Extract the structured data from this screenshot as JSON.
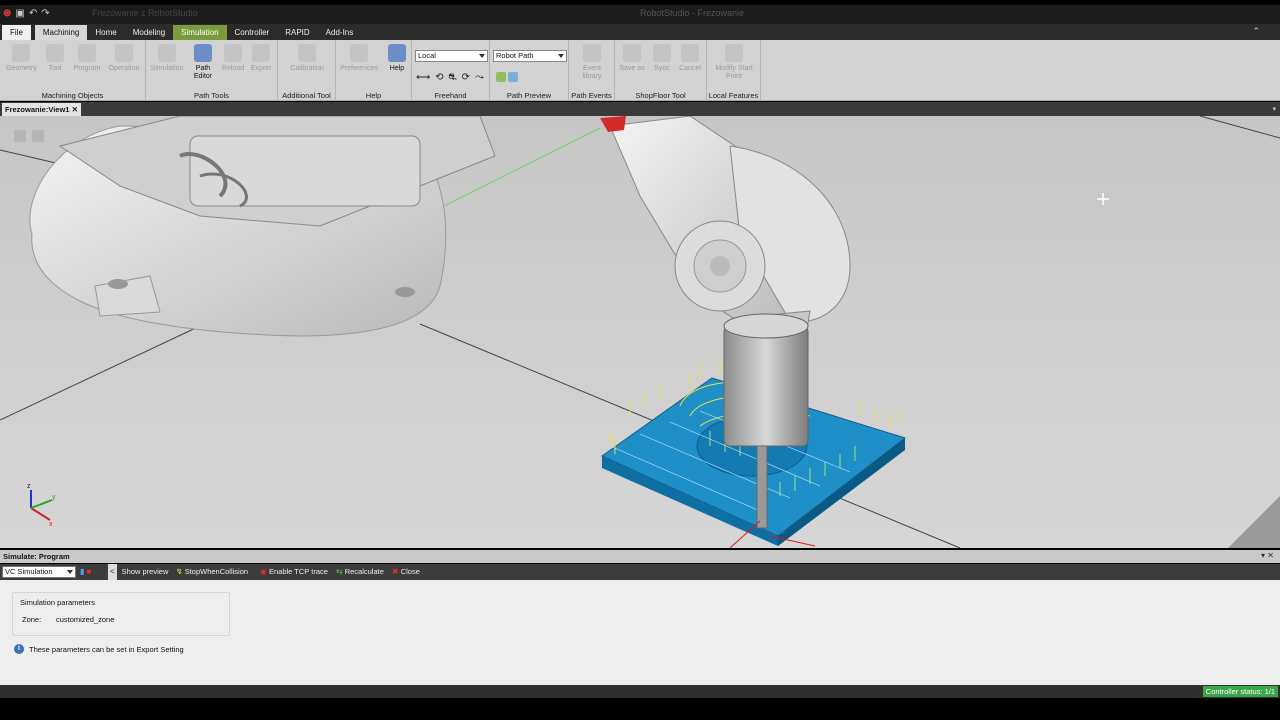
{
  "titlebar": {
    "quick_title": "Frezowanie z RobotStudio",
    "window_title": "RobotStudio - Frezowanie"
  },
  "tabs": [
    {
      "label": "File"
    },
    {
      "label": "Machining"
    },
    {
      "label": "Home"
    },
    {
      "label": "Modeling"
    },
    {
      "label": "Simulation"
    },
    {
      "label": "Controller"
    },
    {
      "label": "RAPID"
    },
    {
      "label": "Add-Ins"
    }
  ],
  "ribbon": {
    "machining_objects": {
      "label": "Machining Objects",
      "buttons": [
        "Geometry",
        "Tool",
        "Program",
        "Operation"
      ]
    },
    "path_tools": {
      "label": "Path Tools",
      "buttons": [
        "Simulation",
        "Path Editor",
        "Reload",
        "Export"
      ]
    },
    "additional_tool": {
      "label": "Additional Tool",
      "buttons": [
        "Calibration"
      ]
    },
    "help_group": {
      "label": "Help",
      "buttons": [
        "Preferences",
        "Help"
      ]
    },
    "freehand": {
      "label": "Freehand",
      "frame_value": "Local",
      "icons": "⟷ ⟲ ⛐ ⟳ ⤳"
    },
    "path_preview": {
      "label": "Path Preview",
      "value": "Robot Path"
    },
    "path_events": {
      "label": "Path Events",
      "buttons": [
        "Event library"
      ]
    },
    "shopfloor": {
      "label": "ShopFloor Tool",
      "buttons": [
        "Save as",
        "Sync",
        "Cancel"
      ]
    },
    "local_features": {
      "label": "Local Features",
      "buttons": [
        "Modify Start Point"
      ]
    }
  },
  "viewport": {
    "tab_label": "Frezowanie:View1",
    "close": "✕"
  },
  "sim_panel": {
    "title": "Simulate: Program",
    "controller_select": "VC Simulation",
    "controls": [
      "Show preview",
      "StopWhenCollision",
      "Enable TCP trace",
      "Recalculate",
      "Close"
    ],
    "group_title": "Simulation parameters",
    "zone_label": "Zone:",
    "zone_value": "customized_zone",
    "info_text": "These parameters can be set in Export Setting"
  },
  "status": {
    "controller_status": "Controller status: 1/1"
  },
  "colors": {
    "workpiece": "#1f8fc8",
    "toolpath_a": "#e8e24a",
    "toolpath_b": "#9fe07a",
    "simulation_tab": "#7a9b3c",
    "status_ok": "#3aa64a"
  }
}
